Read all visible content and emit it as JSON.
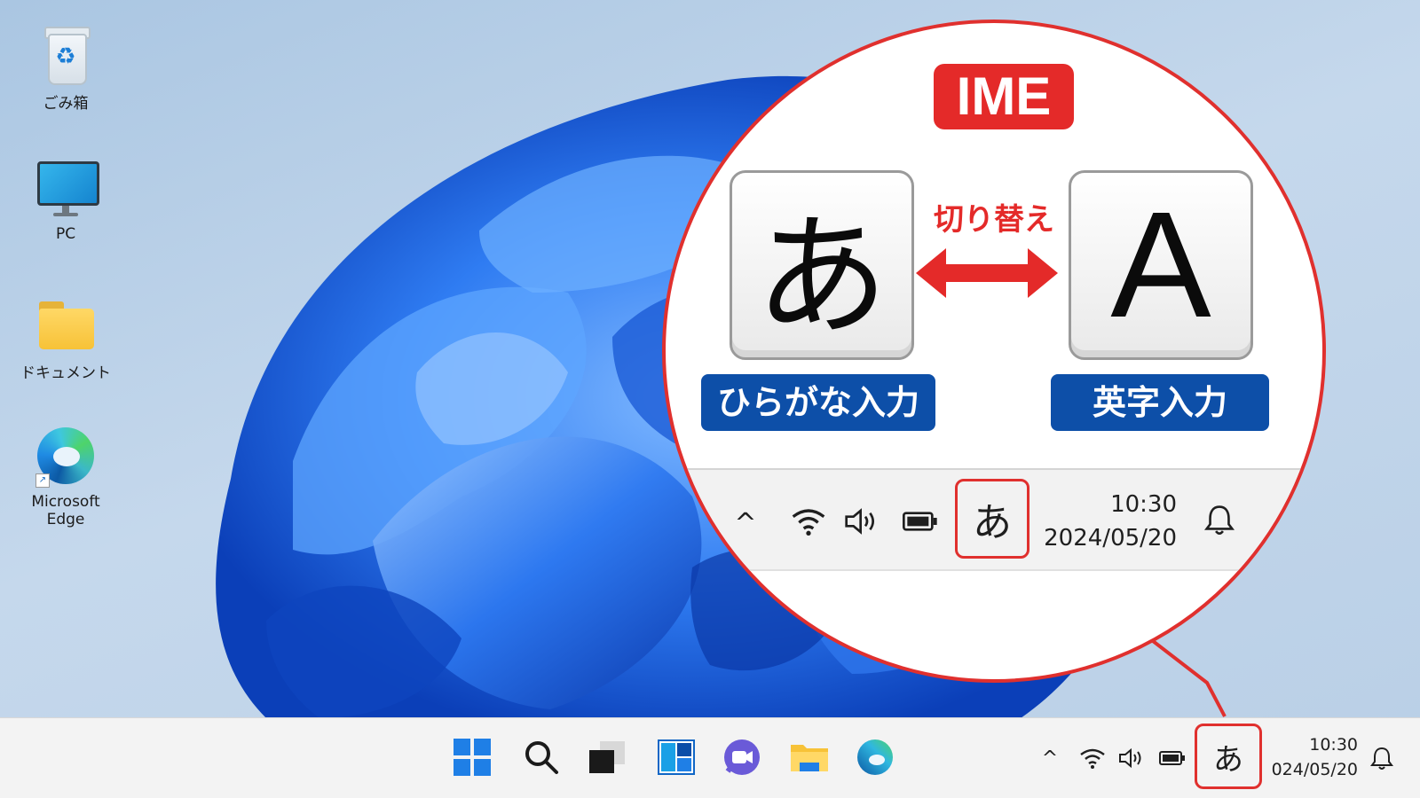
{
  "desktop": {
    "icons": [
      {
        "label": "ごみ箱",
        "icon": "recycle-bin-icon"
      },
      {
        "label": "PC",
        "icon": "monitor-icon"
      },
      {
        "label": "ドキュメント",
        "icon": "folder-icon"
      },
      {
        "label": "Microsoft Edge",
        "icon": "edge-icon"
      }
    ]
  },
  "taskbar": {
    "apps": [
      "start-icon",
      "search-icon",
      "task-view-icon",
      "widgets-icon",
      "chat-icon",
      "file-explorer-icon",
      "edge-icon"
    ],
    "tray": {
      "chevron": "^",
      "ime_indicator": "あ",
      "time": "10:30",
      "date": "024/05/20"
    }
  },
  "callout": {
    "badge": "IME",
    "switch_label": "切り替え",
    "hiragana_key": "あ",
    "alpha_key": "A",
    "hiragana_mode_label": "ひらがな入力",
    "alpha_mode_label": "英字入力",
    "tray": {
      "chevron": "^",
      "ime_indicator": "あ",
      "time": "10:30",
      "date": "2024/05/20"
    }
  },
  "colors": {
    "highlight_red": "#e0302e",
    "label_blue": "#0d4fa8",
    "accent_blue": "#1f6fe0"
  }
}
